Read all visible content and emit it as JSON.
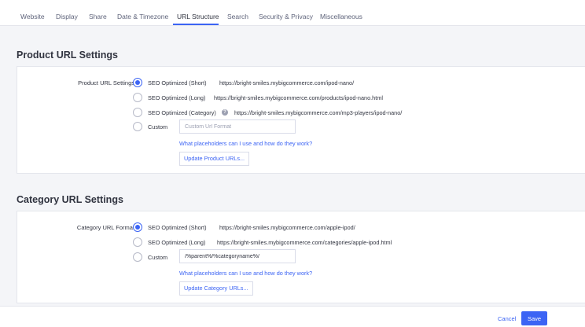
{
  "tabs": [
    {
      "label": "Website"
    },
    {
      "label": "Display"
    },
    {
      "label": "Share"
    },
    {
      "label": "Date & Timezone"
    },
    {
      "label": "URL Structure",
      "active": true
    },
    {
      "label": "Search"
    },
    {
      "label": "Security & Privacy"
    },
    {
      "label": "Miscellaneous"
    }
  ],
  "product": {
    "title": "Product URL Settings",
    "field_label": "Product URL Settings",
    "options": [
      {
        "label": "SEO Optimized (Short)",
        "url": "https://bright-smiles.mybigcommerce.com/ipod-nano/",
        "checked": true
      },
      {
        "label": "SEO Optimized (Long)",
        "url": "https://bright-smiles.mybigcommerce.com/products/ipod-nano.html"
      },
      {
        "label": "SEO Optimized (Category)",
        "url": "https://bright-smiles.mybigcommerce.com/mp3-players/ipod-nano/",
        "help_icon": "?"
      },
      {
        "label": "Custom"
      }
    ],
    "custom_placeholder": "Custom Url Format",
    "custom_value": "",
    "help_link": "What placeholders can I use and how do they work?",
    "update_button": "Update Product URLs..."
  },
  "category": {
    "title": "Category URL Settings",
    "field_label": "Category URL Format",
    "options": [
      {
        "label": "SEO Optimized (Short)",
        "url": "https://bright-smiles.mybigcommerce.com/apple-ipod/",
        "checked": true
      },
      {
        "label": "SEO Optimized (Long)",
        "url": "https://bright-smiles.mybigcommerce.com/categories/apple-ipod.html"
      },
      {
        "label": "Custom"
      }
    ],
    "custom_value": "/%parent%/%categoryname%/",
    "help_link": "What placeholders can I use and how do they work?",
    "update_button": "Update Category URLs..."
  },
  "footer": {
    "cancel": "Cancel",
    "save": "Save"
  },
  "colors": {
    "accent": "#3c64f4",
    "background": "#f4f5f8",
    "text": "#313440"
  }
}
